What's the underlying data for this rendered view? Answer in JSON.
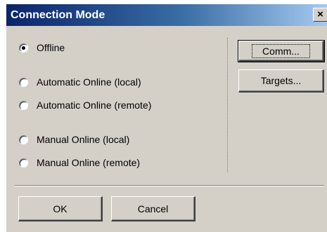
{
  "window": {
    "title": "Connection Mode",
    "close_glyph": "×"
  },
  "mode_options": [
    {
      "label": "Offline",
      "checked": true
    },
    {
      "label": "Automatic Online (local)",
      "checked": false
    },
    {
      "label": "Automatic Online (remote)",
      "checked": false
    },
    {
      "label": "Manual Online (local)",
      "checked": false
    },
    {
      "label": "Manual Online (remote)",
      "checked": false
    }
  ],
  "buttons": {
    "comm": "Comm...",
    "targets": "Targets...",
    "ok": "OK",
    "cancel": "Cancel"
  },
  "colors": {
    "titlebar_start": "#0a246a",
    "titlebar_end": "#a6caf0",
    "face": "#d4d0c8"
  }
}
